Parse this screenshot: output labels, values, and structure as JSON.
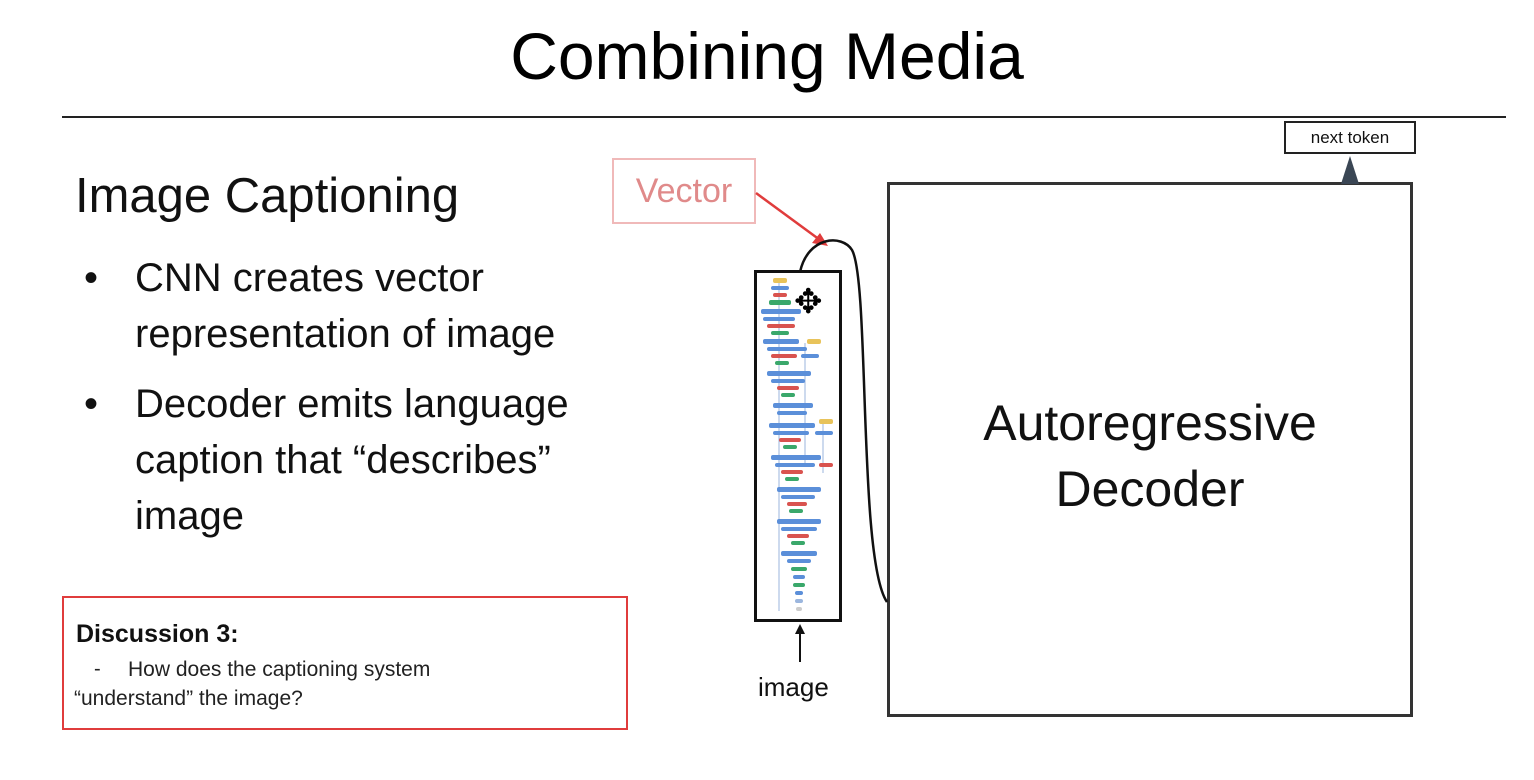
{
  "slide": {
    "title": "Combining Media",
    "subtitle": "Image Captioning",
    "bullets": [
      {
        "marker": "•",
        "lines": [
          "CNN creates vector",
          "representation of image"
        ]
      },
      {
        "marker": "•",
        "lines": [
          "Decoder emits language",
          "caption that “describes”",
          "image"
        ]
      }
    ],
    "discussion": {
      "heading": "Discussion 3:",
      "dash": "-",
      "line1": "How does the captioning system",
      "line2": "“understand” the image?"
    },
    "diagram": {
      "vector_label": "Vector",
      "image_label": "image",
      "decoder_label_lines": [
        "Autoregressive",
        "Decoder"
      ],
      "next_token_label": "next token"
    }
  },
  "cursor": {
    "icon": "move-cursor-icon",
    "glyph": "✥"
  },
  "colors": {
    "accent_red": "#e03c3c",
    "vector_text": "#e08a8a",
    "vector_border": "#f0b9b9",
    "cnn_blue": "#5b8fd9",
    "cnn_green": "#3aa86b",
    "cnn_red": "#d9534f",
    "cnn_yellow": "#e8c35a"
  }
}
